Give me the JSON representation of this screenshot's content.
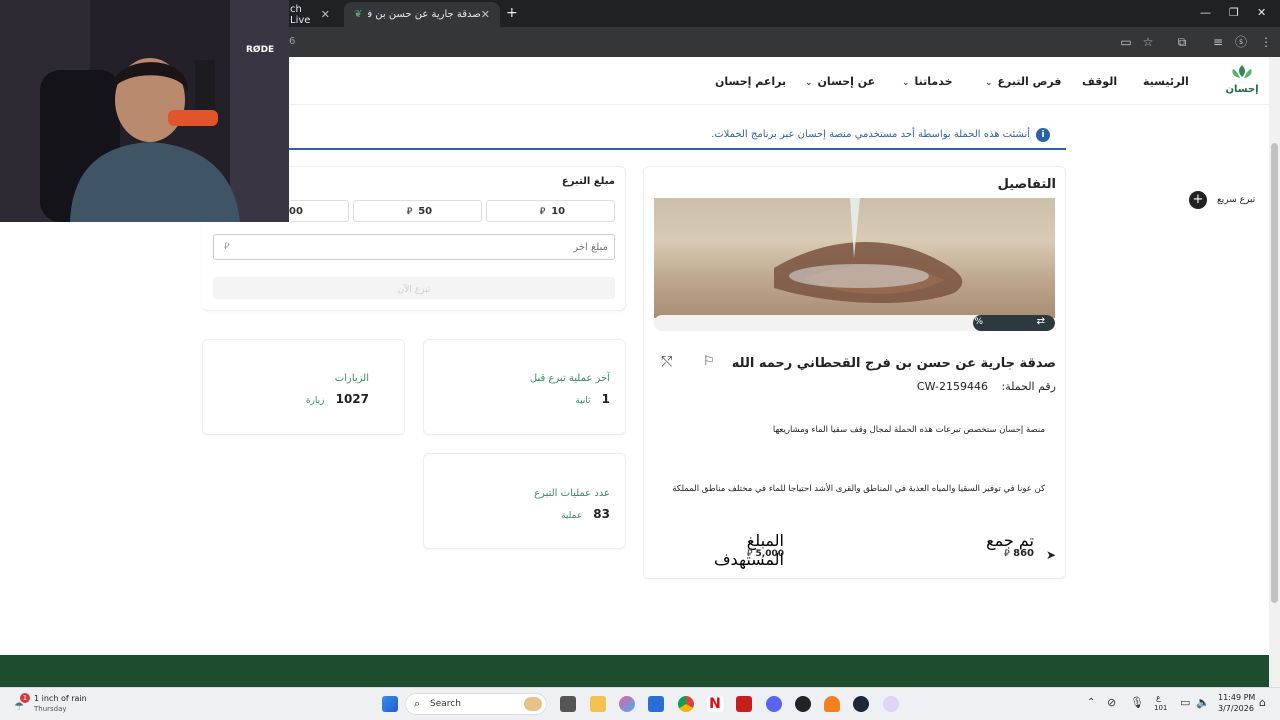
{
  "browser": {
    "tabs": [
      {
        "label": "ch Live"
      },
      {
        "label": "صدقة جارية عن حسن بن فرج ال..."
      }
    ],
    "url_fragment": "6"
  },
  "nav": {
    "logo_text": "إحسان",
    "items": [
      {
        "label": "الرئيسية"
      },
      {
        "label": "الوقف"
      },
      {
        "label": "فرص التبرع"
      },
      {
        "label": "خدماتنا"
      },
      {
        "label": "عن إحسان"
      },
      {
        "label": "براعم إحسان"
      }
    ]
  },
  "banner": {
    "text": "أنشئت هذه الحملة بواسطة أحد مستخدمي منصة إحسان عبر برنامج الحملات."
  },
  "quick_donate": {
    "label": "تبرع سريع"
  },
  "details": {
    "heading": "التفاصيل",
    "progress_label": "%",
    "title": "صدقة جارية عن حسن بن فرج القحطاني رحمه الله",
    "campaign_no_label": "رقم الحملة:",
    "campaign_no": "CW-2159446",
    "desc1": "منصة إحسان ستخصص تبرعات هذه الحملة لمجال وقف سقيا الماء ومشاريعها",
    "desc2": "كن عونا في توفير السقيا والمياه العذبة في المناطق والقرى الأشد احتياجا للماء في مختلف مناطق المملكة",
    "collected_label": "تم جمع",
    "collected": "860",
    "target_label": "المبلغ المستهدف",
    "target": "5,000"
  },
  "donation": {
    "heading": "مبلغ التبرع",
    "amounts": [
      "10",
      "50",
      "00"
    ],
    "other_placeholder": "مبلغ آخر",
    "donate_now": "تبرع الآن"
  },
  "stats": {
    "last_donation_label": "آخر عملية تبرع قبل",
    "last_donation_value": "1",
    "last_donation_unit": "ثانية",
    "visits_label": "الزيارات",
    "visits_value": "1027",
    "visits_unit": "زيارة",
    "ops_label": "عدد عمليات التبرع",
    "ops_value": "83",
    "ops_unit": "عملية"
  },
  "currency_symbol": "⃁",
  "webcam": {
    "mic_brand": "RØDE"
  },
  "taskbar": {
    "weather_badge": "1",
    "weather_text": "1 inch of rain",
    "weather_day": "Thursday",
    "search_label": "Search",
    "lang": "ع",
    "lang_sub": "101",
    "time": "11:49 PM",
    "date": "3/7/2026"
  },
  "colors": {
    "brand_green": "#1f6b43",
    "footer_green": "#1d4d2c",
    "info_blue": "#2c63a8"
  }
}
